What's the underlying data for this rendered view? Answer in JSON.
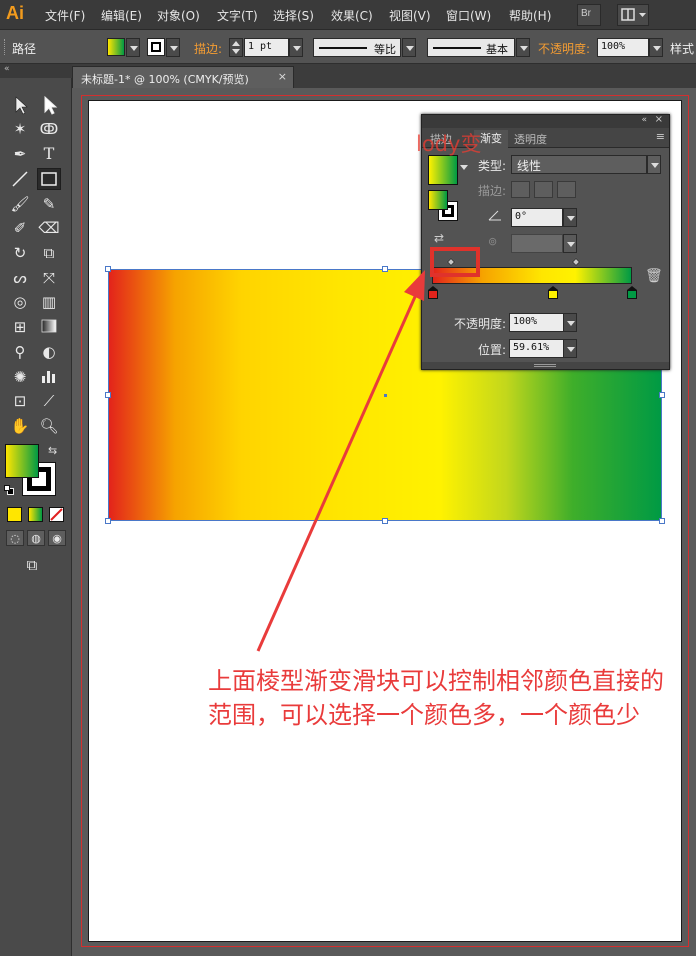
{
  "menubar": {
    "logo": "Ai",
    "items": [
      "文件(F)",
      "编辑(E)",
      "对象(O)",
      "文字(T)",
      "选择(S)",
      "效果(C)",
      "视图(V)",
      "窗口(W)",
      "帮助(H)"
    ],
    "bridge_label": "Br"
  },
  "controlbar": {
    "object_type": "路径",
    "stroke_label": "描边:",
    "stroke_weight": "1 pt",
    "profile_label": "等比",
    "brush_label": "基本",
    "opacity_label": "不透明度:",
    "opacity_value": "100%",
    "style_label": "样式"
  },
  "document_tab": {
    "title": "未标题-1* @ 100% (CMYK/预览)",
    "close": "×"
  },
  "gradient_panel": {
    "tabs": [
      "描边",
      "渐变",
      "透明度"
    ],
    "type_label": "类型:",
    "type_value": "线性",
    "stroke_label": "描边:",
    "angle_value": "0°",
    "opacity_label": "不透明度:",
    "opacity_value": "100%",
    "location_label": "位置:",
    "location_value": "59.61%",
    "stop_colors": [
      "#e3231b",
      "#fff200",
      "#009a44"
    ]
  },
  "colors": {
    "fill_gradient_start": "#ffe600",
    "fill_gradient_end": "#009a44",
    "annotation_color": "#e93b3b"
  },
  "watermark": "lody变",
  "annotation": "上面棱型渐变滑块可以控制相邻颜色直接的范围，可以选择一个颜色多，一个颜色少"
}
